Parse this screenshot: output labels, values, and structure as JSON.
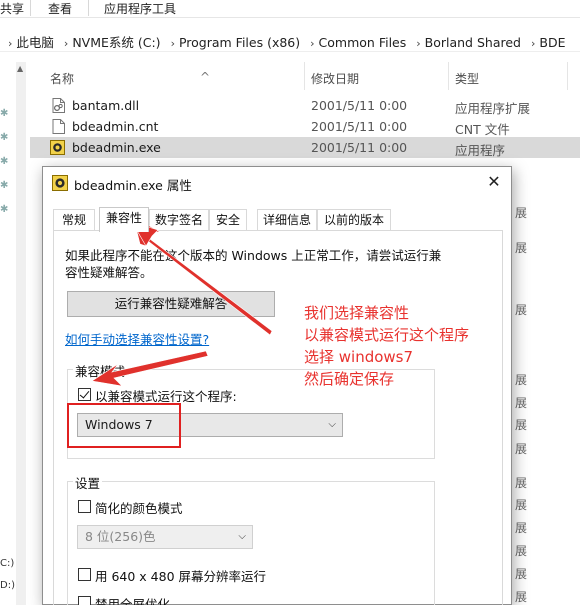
{
  "ribbon": {
    "tabs": [
      "共享",
      "查看",
      "应用程序工具"
    ]
  },
  "address": {
    "crumbs": [
      "此电脑",
      "NVME系统 (C:)",
      "Program Files (x86)",
      "Common Files",
      "Borland Shared",
      "BDE"
    ]
  },
  "left_nav": {
    "drives": [
      "C:)",
      "D:)"
    ]
  },
  "file_list": {
    "columns": {
      "name": "名称",
      "date": "修改日期",
      "type": "类型"
    },
    "rows": [
      {
        "name": "bantam.dll",
        "date": "2001/5/11 0:00",
        "type": "应用程序扩展",
        "icon": "dll-file-icon"
      },
      {
        "name": "bdeadmin.cnt",
        "date": "2001/5/11 0:00",
        "type": "CNT 文件",
        "icon": "generic-file-icon"
      },
      {
        "name": "bdeadmin.exe",
        "date": "2001/5/11 0:00",
        "type": "应用程序",
        "icon": "bde-app-icon",
        "selected": true
      }
    ],
    "right_fragment": "展"
  },
  "dialog": {
    "title": "bdeadmin.exe 属性",
    "close_glyph": "✕",
    "tabs": [
      "常规",
      "兼容性",
      "数字签名",
      "安全",
      "详细信息",
      "以前的版本"
    ],
    "active_tab": "兼容性",
    "intro_line1": "如果此程序不能在这个版本的 Windows 上正常工作，请尝试运行兼",
    "intro_line2": "容性疑难解答。",
    "troubleshoot_button": "运行兼容性疑难解答",
    "manual_link": "如何手动选择兼容性设置?",
    "compat_mode": {
      "group_label": "兼容模式",
      "checkbox_label": "以兼容模式运行这个程序:",
      "checked": true,
      "os_selected": "Windows 7"
    },
    "settings": {
      "group_label": "设置",
      "reduced_color_label": "简化的颜色模式",
      "reduced_color_checked": false,
      "color_option": "8 位(256)色",
      "res640_label": "用 640 x 480 屏幕分辨率运行",
      "res640_checked": false,
      "fullscreen_label": "禁用全屏优化",
      "fullscreen_checked": false
    }
  },
  "annotation": {
    "lines": [
      "我们选择兼容性",
      "以兼容模式运行这个程序",
      "选择 windows7",
      "然后确定保存"
    ],
    "color": "#e8322e"
  }
}
